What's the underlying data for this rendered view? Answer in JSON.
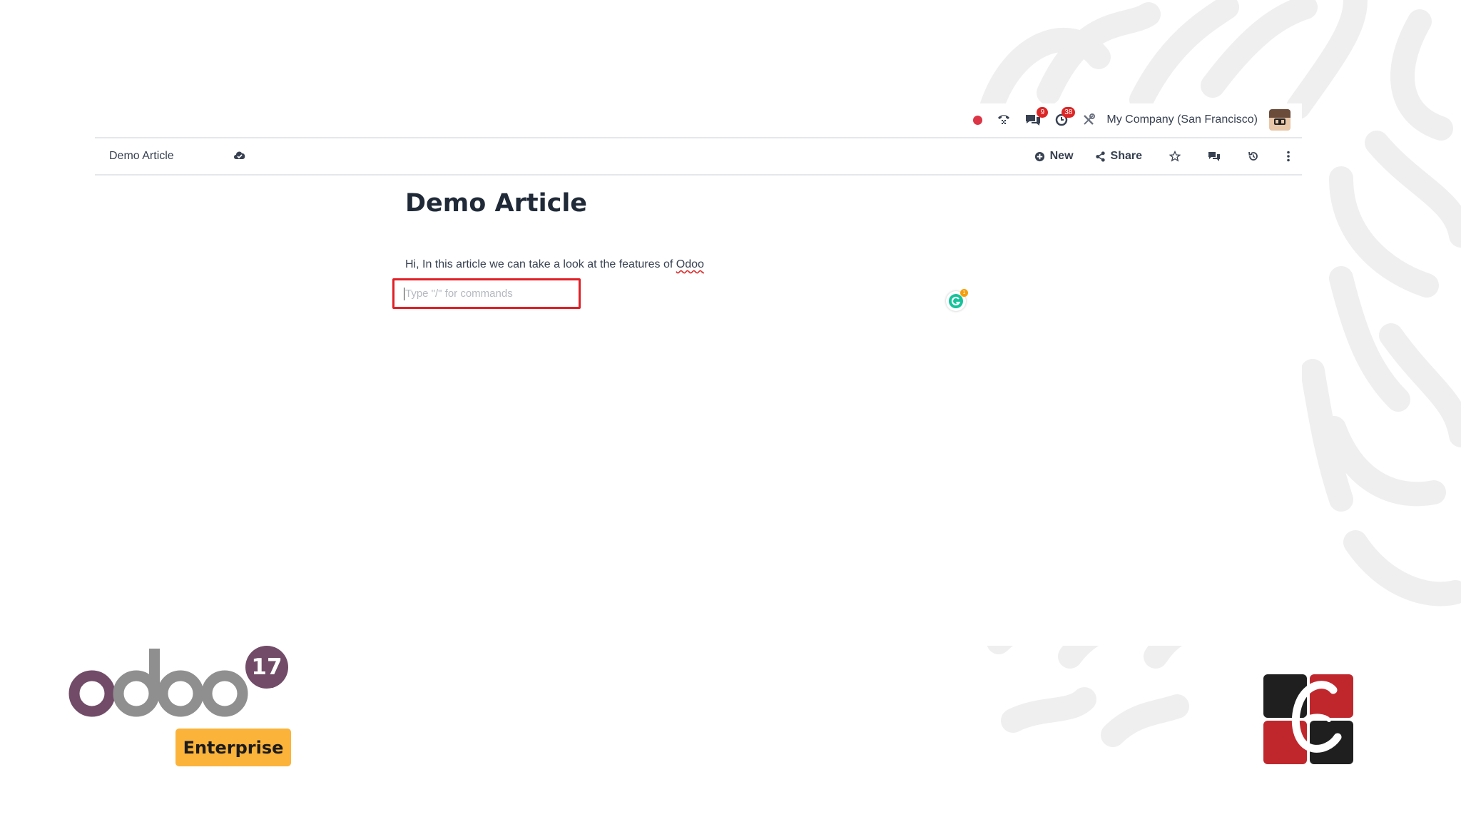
{
  "topbar": {
    "messages_badge": "9",
    "activities_badge": "38",
    "company": "My Company (San Francisco)"
  },
  "control": {
    "breadcrumb": "Demo Article",
    "new_label": "New",
    "share_label": "Share"
  },
  "article": {
    "title": "Demo Article",
    "body_prefix": "Hi, In this article we can take a look at the features of ",
    "body_spellword": "Odoo",
    "command_placeholder": "Type \"/\" for commands"
  },
  "branding": {
    "logo_text": "odoo",
    "version": "17",
    "edition": "Enterprise"
  },
  "colors": {
    "highlight_border": "#e21f26",
    "odoo_purple": "#714b67",
    "odoo_gray": "#8f8f8f",
    "enterprise_yellow": "#fbb33a",
    "badge_red": "#dc2626"
  }
}
